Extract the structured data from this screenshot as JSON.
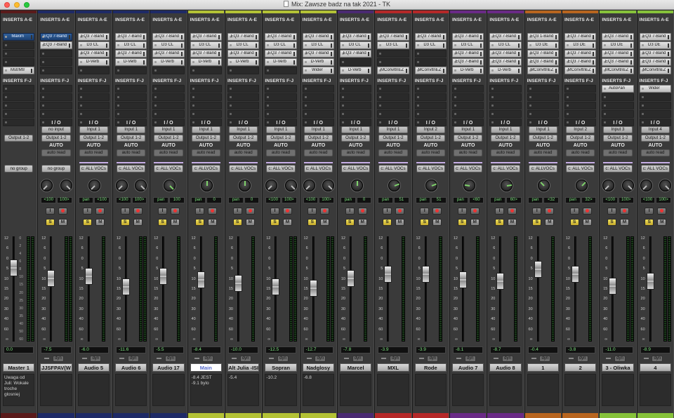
{
  "window": {
    "title": "Mix: Zawsze badz na tak 2021 - TK"
  },
  "labels": {
    "inserts_ae": "INSERTS A-E",
    "inserts_fj": "INSERTS F-J",
    "io": "I / O",
    "auto": "AUTO",
    "solo": "S",
    "mute": "M",
    "input_enable": "I",
    "dyn": "dyn"
  },
  "fader_scale": [
    "12",
    "6",
    "0",
    "5",
    "10",
    "15",
    "20",
    "30",
    "40",
    "60",
    "∞"
  ],
  "meter_scale": [
    "0",
    "2",
    "4",
    "6",
    "8",
    "10",
    "15",
    "20",
    "25",
    "30",
    "35",
    "40",
    "50",
    "60"
  ],
  "tracks": [
    {
      "name": "Master 1",
      "color": "#5a1a1a",
      "inserts_ae": [
        {
          "name": "Maxim",
          "active": true
        },
        null,
        null,
        null,
        {
          "name": "MstrMtr"
        }
      ],
      "inserts_fj": [],
      "input": "",
      "output": "Output 1-2",
      "auto": "",
      "group": "no group",
      "pan_l": "",
      "pan_r": "",
      "mono": false,
      "volume": "0.0",
      "fader": 0.74,
      "comment": "Uwaga od\nJuli: Wokale\ntroche glosniej",
      "is_master": true,
      "highlight": false
    },
    {
      "name": "JJSFPAV(W",
      "color": "#1e2a66",
      "inserts_ae": [
        {
          "name": "EQ3 7-Band",
          "active": true
        },
        {
          "name": "EQ3 7-Band"
        },
        null,
        null,
        null
      ],
      "inserts_fj": [],
      "input": "no input",
      "output": "Output 1-2",
      "auto": "auto read",
      "group": "no group",
      "pan_l": "<100",
      "pan_r": "100>",
      "mono": false,
      "volume": "-7.5",
      "fader": 0.62,
      "comment": "",
      "highlight": false
    },
    {
      "name": "Audio 5",
      "color": "#1e2a66",
      "inserts_ae": [
        {
          "name": "EQ3 7-Band"
        },
        {
          "name": "D3 CL"
        },
        {
          "name": "EQ3 7-Band"
        },
        {
          "name": "D-Verb"
        },
        null
      ],
      "inserts_fj": [],
      "input": "Input 1",
      "output": "Output 1-2",
      "auto": "auto read",
      "group": "c: ALL VOCs",
      "pan_l": "pan",
      "pan_r": "<100",
      "mono": true,
      "volume": "-6.0",
      "fader": 0.64,
      "comment": "",
      "highlight": false
    },
    {
      "name": "Audio 6",
      "color": "#1e2a66",
      "inserts_ae": [
        {
          "name": "EQ3 7-Band"
        },
        {
          "name": "D3 CL"
        },
        {
          "name": "EQ3 7-Band"
        },
        {
          "name": "D-Verb"
        },
        null
      ],
      "inserts_fj": [],
      "input": "Input 1",
      "output": "Output 1-2",
      "auto": "auto read",
      "group": "c: ALL VOCs",
      "pan_l": "<100",
      "pan_r": "100>",
      "mono": false,
      "volume": "-11.6",
      "fader": 0.52,
      "comment": "",
      "highlight": false
    },
    {
      "name": "Audio 17",
      "color": "#1e2a66",
      "inserts_ae": [
        {
          "name": "EQ3 7-Band"
        },
        {
          "name": "D3 CL"
        },
        {
          "name": "EQ3 7-Band"
        },
        {
          "name": "D-Verb"
        },
        null
      ],
      "inserts_fj": [],
      "input": "Input 1",
      "output": "Output 1-2",
      "auto": "auto read",
      "group": "c: ALL VOCs",
      "pan_l": "pan",
      "pan_r": "100",
      "mono": true,
      "volume": "-5.5",
      "fader": 0.64,
      "comment": "",
      "highlight": false
    },
    {
      "name": "Main",
      "color": "#b3c235",
      "inserts_ae": [
        {
          "name": "EQ3 7-Band"
        },
        {
          "name": "D3 CL"
        },
        {
          "name": "EQ3 7-Band"
        },
        {
          "name": "D-Verb"
        },
        null
      ],
      "inserts_fj": [],
      "input": "Input 1",
      "output": "Output 1-2",
      "auto": "auto read",
      "group": "c: ALLVOCs",
      "pan_l": "pan",
      "pan_r": "0",
      "mono": true,
      "volume": "-8.4",
      "fader": 0.6,
      "comment": "-8.4 JEST\n-9.1 bylo",
      "highlight": true
    },
    {
      "name": "Alt Julia -ISI",
      "color": "#b3c235",
      "inserts_ae": [
        {
          "name": "EQ3 7-Band"
        },
        {
          "name": "D3 CL"
        },
        {
          "name": "EQ3 7-Band"
        },
        {
          "name": "D-Verb"
        },
        null
      ],
      "inserts_fj": [],
      "input": "Input 1",
      "output": "Output 1-2",
      "auto": "auto read",
      "group": "c: ALL VOCs",
      "pan_l": "pan",
      "pan_r": "0",
      "mono": true,
      "volume": "-10.0",
      "fader": 0.56,
      "comment": "-5.4",
      "highlight": false
    },
    {
      "name": "Sopran",
      "color": "#b3c235",
      "inserts_ae": [
        {
          "name": "EQ3 7-Band"
        },
        {
          "name": "D3 CL"
        },
        {
          "name": "EQ3 7-Band"
        },
        {
          "name": "D-Verb"
        },
        null
      ],
      "inserts_fj": [],
      "input": "Input 1",
      "output": "Output 1-2",
      "auto": "auto read",
      "group": "c: ALL VOCs",
      "pan_l": "<100",
      "pan_r": "100>",
      "mono": false,
      "volume": "-12.5",
      "fader": 0.52,
      "comment": "-10.2",
      "highlight": false
    },
    {
      "name": "Nadglosy",
      "color": "#b3c235",
      "inserts_ae": [
        {
          "name": "EQ3 7-Band"
        },
        {
          "name": "D3 CL"
        },
        {
          "name": "EQ3 7-Band"
        },
        {
          "name": "D-Verb"
        },
        {
          "name": "Wider"
        }
      ],
      "inserts_fj": [],
      "input": "Input 1",
      "output": "Output 1-2",
      "auto": "auto read",
      "group": "c: ALL VOCs",
      "pan_l": "<100",
      "pan_r": "100>",
      "mono": false,
      "volume": "-12.7",
      "fader": 0.51,
      "comment": "-6.8",
      "highlight": false
    },
    {
      "name": "Marcel",
      "color": "#4a2a72",
      "inserts_ae": [
        {
          "name": "EQ3 7-Band"
        },
        {
          "name": "D3 CL"
        },
        {
          "name": "EQ3 7-Band"
        },
        null,
        {
          "name": "D-Verb"
        }
      ],
      "inserts_fj": [],
      "input": "Input 1",
      "output": "Output 1-2",
      "auto": "auto read",
      "group": "c: ALL VOCs",
      "pan_l": "pan",
      "pan_r": "0",
      "mono": true,
      "volume": "-7.8",
      "fader": 0.62,
      "comment": "",
      "highlight": false
    },
    {
      "name": "MXL",
      "color": "#b52828",
      "inserts_ae": [
        {
          "name": "EQ3 7-Band"
        },
        {
          "name": "D3 CL"
        },
        null,
        null,
        {
          "name": "MConvltnEZ"
        }
      ],
      "inserts_fj": [],
      "input": "Input 1",
      "output": "Output 1-2",
      "auto": "auto read",
      "group": "c: ALL VOCs",
      "pan_l": "pan",
      "pan_r": "51",
      "mono": true,
      "volume": "-3.9",
      "fader": 0.67,
      "comment": "",
      "highlight": false
    },
    {
      "name": "Rode",
      "color": "#b52828",
      "inserts_ae": [
        {
          "name": "EQ3 7-Band"
        },
        {
          "name": "D3 CL"
        },
        null,
        null,
        {
          "name": "MConvltnEZ"
        }
      ],
      "inserts_fj": [],
      "input": "Input 2",
      "output": "Output 1-2",
      "auto": "auto read",
      "group": "c: ALL VOCs",
      "pan_l": "pan",
      "pan_r": "51",
      "mono": true,
      "volume": "-3.9",
      "fader": 0.67,
      "comment": "",
      "highlight": false
    },
    {
      "name": "Audio 7",
      "color": "#6a2a86",
      "inserts_ae": [
        {
          "name": "EQ3 7-Band"
        },
        {
          "name": "D3 CL"
        },
        {
          "name": "EQ3 7-Band"
        },
        {
          "name": "EQ3 7-Band"
        },
        {
          "name": "D-Verb"
        }
      ],
      "inserts_fj": [],
      "input": "Input 1",
      "output": "Output 1-2",
      "auto": "auto read",
      "group": "c: ALL VOCs",
      "pan_l": "pan",
      "pan_r": "<60",
      "mono": true,
      "volume": "-8.1",
      "fader": 0.6,
      "comment": "",
      "highlight": false
    },
    {
      "name": "Audio 8",
      "color": "#6a2a86",
      "inserts_ae": [
        {
          "name": "EQ3 7-Band"
        },
        {
          "name": "D3 CL"
        },
        {
          "name": "EQ3 7-Band"
        },
        {
          "name": "EQ3 7-Band"
        },
        {
          "name": "D-Verb"
        }
      ],
      "inserts_fj": [],
      "input": "Input 1",
      "output": "Output 1-2",
      "auto": "auto read",
      "group": "c: ALL VOCs",
      "pan_l": "pan",
      "pan_r": "60>",
      "mono": true,
      "volume": "-8.7",
      "fader": 0.59,
      "comment": "",
      "highlight": false
    },
    {
      "name": "1",
      "color": "#b8651f",
      "inserts_ae": [
        {
          "name": "EQ3 1-Band"
        },
        {
          "name": "D3 DE"
        },
        {
          "name": "EQ3 7-Band"
        },
        {
          "name": "EQ3 7-Band"
        },
        {
          "name": "MConvltnEZ"
        }
      ],
      "inserts_fj": [],
      "input": "Input 1",
      "output": "Output 1-2",
      "auto": "auto read",
      "group": "c: ALLVOCs",
      "pan_l": "pan",
      "pan_r": "<32",
      "mono": true,
      "volume": "-0.4",
      "fader": 0.72,
      "comment": "",
      "highlight": false
    },
    {
      "name": "2",
      "color": "#b8651f",
      "inserts_ae": [
        {
          "name": "EQ3 7-Band"
        },
        {
          "name": "D3 DE"
        },
        {
          "name": "EQ3 7-Band"
        },
        {
          "name": "EQ3 7-Band"
        },
        {
          "name": "MConvltnEZ"
        }
      ],
      "inserts_fj": [],
      "input": "Input 2",
      "output": "Output 1-2",
      "auto": "auto read",
      "group": "c: ALL VOCs",
      "pan_l": "pan",
      "pan_r": "32>",
      "mono": true,
      "volume": "-3.8",
      "fader": 0.67,
      "comment": "",
      "highlight": false
    },
    {
      "name": "3 - Oliwka",
      "color": "#86c23a",
      "inserts_ae": [
        {
          "name": "EQ3 7-Band"
        },
        {
          "name": "D3 DE"
        },
        {
          "name": "EQ3 7-Band"
        },
        {
          "name": "EQ3 7-Band"
        },
        {
          "name": "MConvltnEZ"
        }
      ],
      "inserts_fj": [
        {
          "name": "AutoPan"
        }
      ],
      "input": "Input 3",
      "output": "Output 1-2",
      "auto": "auto read",
      "group": "c: ALL VOCs",
      "pan_l": "<100",
      "pan_r": "100>",
      "mono": false,
      "volume": "-11.0",
      "fader": 0.53,
      "comment": "",
      "highlight": false
    },
    {
      "name": "4",
      "color": "#86c23a",
      "inserts_ae": [
        {
          "name": "EQ3 7-Band"
        },
        {
          "name": "D3 DE"
        },
        {
          "name": "EQ3 7-Band"
        },
        {
          "name": "EQ3 7-Band"
        },
        {
          "name": "MConvltnEZ"
        }
      ],
      "inserts_fj": [
        {
          "name": "Wider"
        }
      ],
      "input": "Input 4",
      "output": "Output 1-2",
      "auto": "auto read",
      "group": "c: ALL VOCs",
      "pan_l": "<100",
      "pan_r": "100>",
      "mono": false,
      "volume": "-8.9",
      "fader": 0.59,
      "comment": "",
      "highlight": false
    }
  ]
}
